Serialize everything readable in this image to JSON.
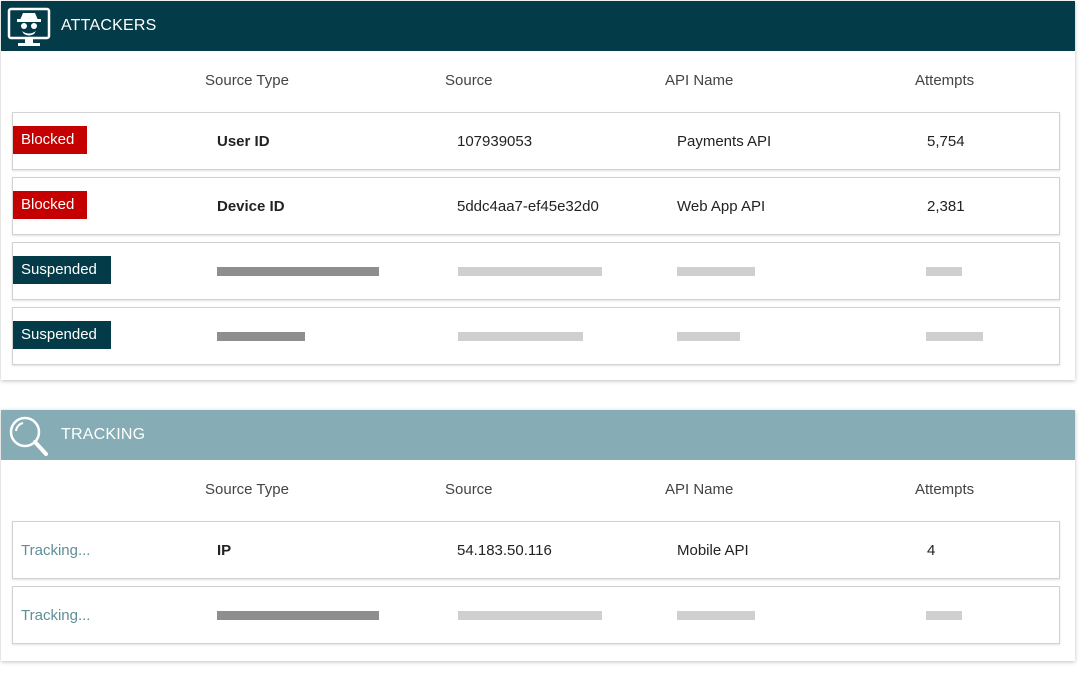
{
  "attackers": {
    "title": "ATTACKERS",
    "icon": "spy-monitor-icon",
    "columns": [
      "Source Type",
      "Source",
      "API Name",
      "Attempts"
    ],
    "rows": [
      {
        "status": "Blocked",
        "source_type": "User ID",
        "source": "107939053",
        "api_name": "Payments API",
        "attempts": "5,754"
      },
      {
        "status": "Blocked",
        "source_type": "Device ID",
        "source": "5ddc4aa7-ef45e32d0",
        "api_name": "Web App API",
        "attempts": "2,381"
      },
      {
        "status": "Suspended"
      },
      {
        "status": "Suspended"
      }
    ]
  },
  "tracking": {
    "title": "TRACKING",
    "icon": "magnifier-icon",
    "columns": [
      "Source Type",
      "Source",
      "API Name",
      "Attempts"
    ],
    "rows": [
      {
        "status": "Tracking...",
        "source_type": "IP",
        "source": "54.183.50.116",
        "api_name": "Mobile API",
        "attempts": "4"
      },
      {
        "status": "Tracking..."
      }
    ]
  },
  "colors": {
    "attackers_header": "#033b48",
    "tracking_header": "#86acb5",
    "blocked": "#c40000",
    "suspended": "#033b48",
    "tracking_text": "#5e8f99"
  }
}
